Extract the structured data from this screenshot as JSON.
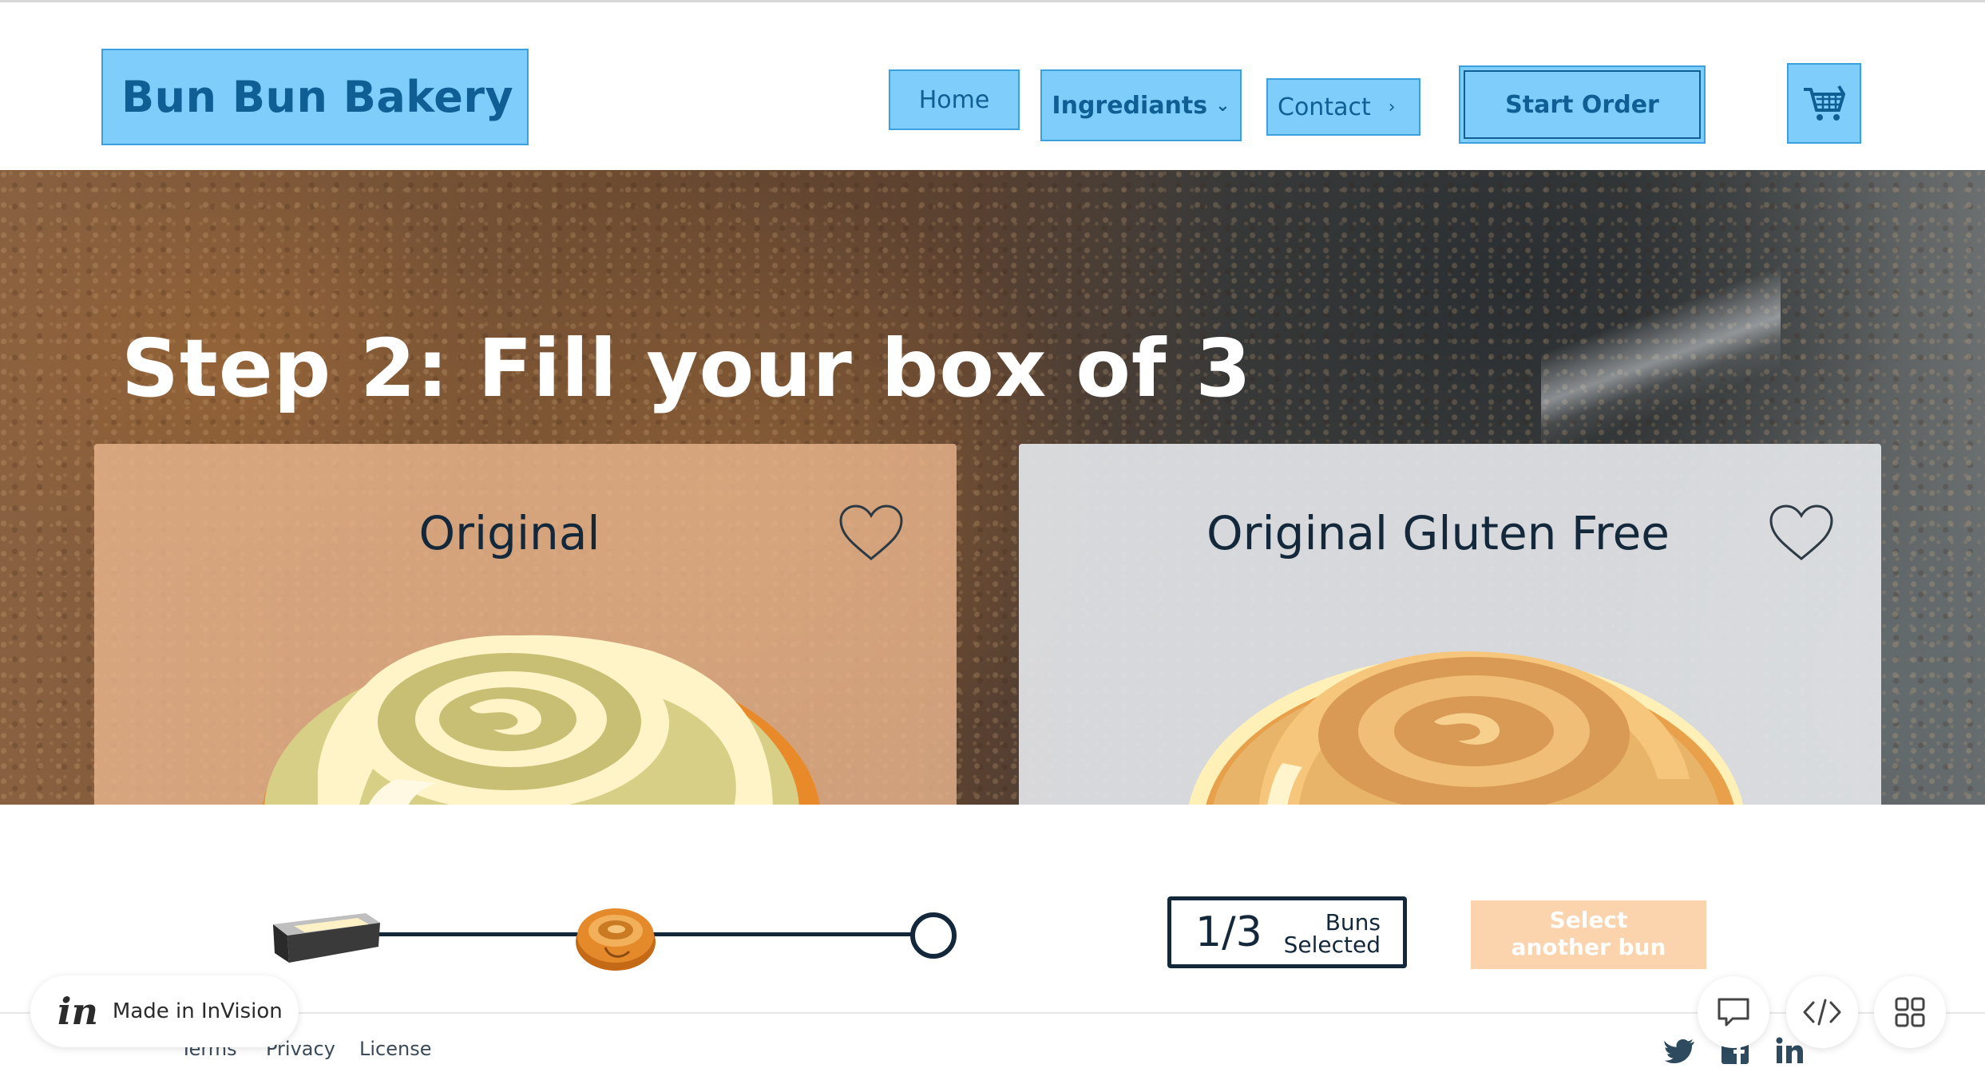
{
  "header": {
    "logo_text": "Bun Bun Bakery",
    "nav": {
      "home": "Home",
      "ingredients": "Ingrediants",
      "contact": "Contact",
      "start_order": "Start Order"
    },
    "cart_icon": "cart-icon"
  },
  "hero": {
    "title_bold": "Step 2:",
    "title_rest": " Fill your box of 3"
  },
  "cards": [
    {
      "title": "Original",
      "icon": "heart-icon"
    },
    {
      "title": "Original Gluten Free",
      "icon": "heart-icon"
    }
  ],
  "progress": {
    "steps": [
      "box-icon",
      "bun-icon",
      "circle-icon"
    ],
    "counter_value": "1/3",
    "counter_label_line1": "Buns",
    "counter_label_line2": "Selected",
    "select_button_line1": "Select",
    "select_button_line2": "another bun"
  },
  "footer": {
    "links": [
      "Terms",
      "Privacy",
      "License"
    ],
    "social": [
      "twitter-icon",
      "facebook-icon",
      "linkedin-icon"
    ]
  },
  "invision": {
    "logo": "in",
    "label": "Made in InVision",
    "tools": [
      "comment-icon",
      "code-icon",
      "grid-icon"
    ]
  },
  "colors": {
    "nav_fill": "#7fcdfb",
    "nav_text": "#0f5f94",
    "dark": "#13283a",
    "card_original": "#e8b58c",
    "card_gluten_free": "#e0e2e5",
    "select_button": "#fbd3ac"
  }
}
